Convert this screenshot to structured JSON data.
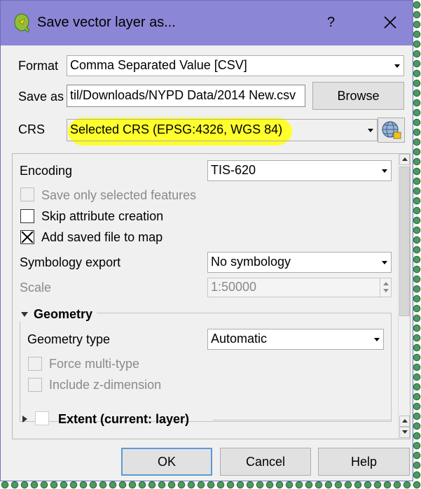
{
  "window": {
    "title": "Save vector layer as...",
    "help_label": "?",
    "app_icon": "qgis-logo-icon",
    "close_icon": "close-icon"
  },
  "form": {
    "format_label": "Format",
    "format_value": "Comma Separated Value [CSV]",
    "save_as_label": "Save as",
    "save_as_value": "til/Downloads/NYPD Data/2014 New.csv",
    "browse_label": "Browse",
    "crs_label": "CRS",
    "crs_value": "Selected CRS (EPSG:4326, WGS 84)",
    "crs_select_icon": "globe-icon",
    "highlight_color": "#ffff2e"
  },
  "options": {
    "encoding_label": "Encoding",
    "encoding_value": "TIS-620",
    "save_selected_label": "Save only selected features",
    "save_selected_checked": false,
    "skip_attr_label": "Skip attribute creation",
    "skip_attr_checked": false,
    "add_to_map_label": "Add saved file to map",
    "add_to_map_checked": true,
    "symbology_label": "Symbology export",
    "symbology_value": "No symbology",
    "scale_label": "Scale",
    "scale_value": "1:50000"
  },
  "geometry": {
    "title": "Geometry",
    "type_label": "Geometry type",
    "type_value": "Automatic",
    "force_multi_label": "Force multi-type",
    "include_z_label": "Include z-dimension"
  },
  "extent": {
    "title": "Extent (current: layer)"
  },
  "buttons": {
    "ok": "OK",
    "cancel": "Cancel",
    "help": "Help"
  }
}
